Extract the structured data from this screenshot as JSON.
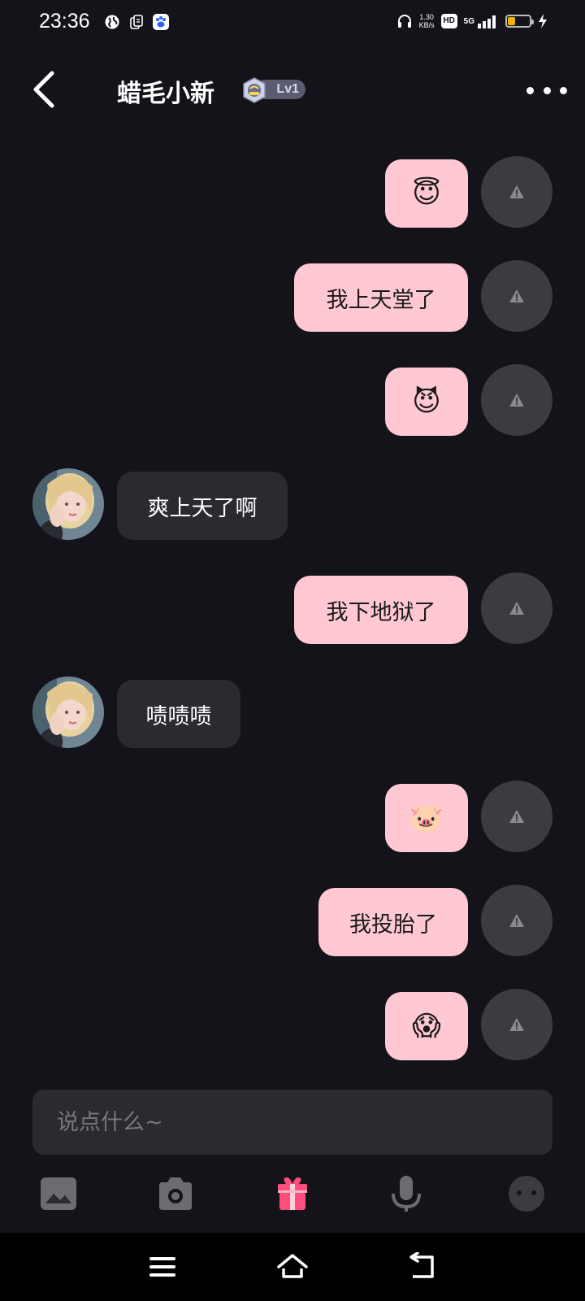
{
  "status_bar": {
    "time": "23:36",
    "net_speed_value": "1.30",
    "net_speed_unit": "KB/s",
    "hd_label": "HD",
    "signal_label": "5G",
    "battery_level": 0.35,
    "battery_color": "#f0b400"
  },
  "header": {
    "title": "蜡毛小新",
    "level_label": "Lv1"
  },
  "messages": [
    {
      "side": "out",
      "text": "😇",
      "icon": "smiling-face-with-halo"
    },
    {
      "side": "out",
      "text": "我上天堂了"
    },
    {
      "side": "out",
      "text": "😈",
      "icon": "smiling-face-with-horns"
    },
    {
      "side": "in",
      "text": "爽上天了啊"
    },
    {
      "side": "out",
      "text": "我下地狱了"
    },
    {
      "side": "in",
      "text": "啧啧啧"
    },
    {
      "side": "out",
      "text": "🐷",
      "icon": "pig-face"
    },
    {
      "side": "out",
      "text": "我投胎了"
    },
    {
      "side": "out",
      "text": "😱",
      "icon": "face-screaming-in-fear"
    }
  ],
  "input": {
    "placeholder": "说点什么~"
  },
  "toolbar": {
    "items": [
      "image-icon",
      "camera-icon",
      "gift-icon",
      "microphone-icon",
      "emoji-icon"
    ],
    "accent_color": "#ff4d7d"
  },
  "colors": {
    "background": "#14131a",
    "outgoing_bubble": "#ffc8d2",
    "incoming_bubble": "#2a2a30"
  }
}
